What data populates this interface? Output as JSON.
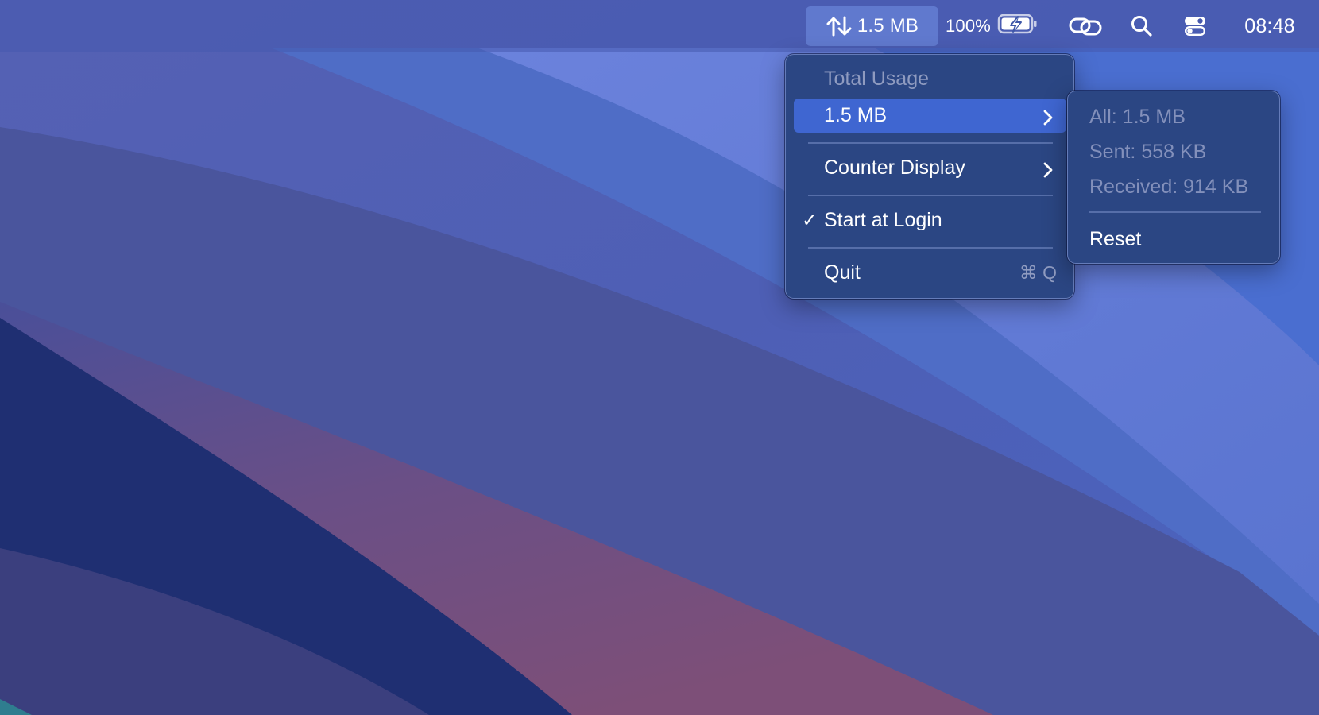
{
  "menubar": {
    "netstat": {
      "icon": "arrows-up-down-icon",
      "label": "1.5 MB"
    },
    "battery": {
      "percent": "100%",
      "icon": "battery-charging-icon"
    },
    "icons": [
      "link-icon",
      "search-icon",
      "control-center-icon"
    ],
    "clock": "08:48"
  },
  "menu": {
    "header": "Total Usage",
    "usage_item": {
      "label": "1.5 MB",
      "icon": "chevron-right-icon",
      "highlighted": true
    },
    "counter_item": {
      "label": "Counter Display",
      "icon": "chevron-right-icon"
    },
    "login_item": {
      "label": "Start at Login",
      "checked": true,
      "check_glyph": "✓"
    },
    "quit_item": {
      "label": "Quit",
      "shortcut": "⌘ Q"
    }
  },
  "submenu": {
    "all": "All: 1.5 MB",
    "sent": "Sent: 558 KB",
    "received": "Received: 914 KB",
    "reset": "Reset"
  },
  "colors": {
    "highlight": "#3f66d1",
    "menu_bg": "#2b4683",
    "disabled_text": "#8f9bc0"
  }
}
